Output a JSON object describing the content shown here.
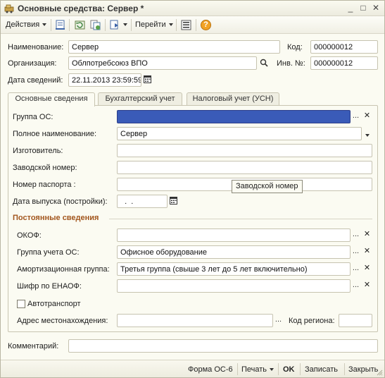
{
  "window": {
    "title": "Основные средства: Сервер *",
    "minimize": "_",
    "maximize": "□",
    "close": "✕"
  },
  "toolbar": {
    "actions_label": "Действия",
    "goto_label": "Перейти",
    "help_symbol": "?"
  },
  "header": {
    "name_label": "Наименование:",
    "name_value": "Сервер",
    "code_label": "Код:",
    "code_value": "000000012",
    "org_label": "Организация:",
    "org_value": "Облпотребсоюз ВПО",
    "inv_label": "Инв. №:",
    "inv_value": "000000012",
    "date_label": "Дата сведений:",
    "date_value": "22.11.2013 23:59:59"
  },
  "tabs": [
    {
      "label": "Основные сведения",
      "active": true
    },
    {
      "label": "Бухгалтерский учет",
      "active": false
    },
    {
      "label": "Налоговый учет (УСН)",
      "active": false
    }
  ],
  "main": {
    "group_os_label": "Группа ОС:",
    "group_os_value": "",
    "full_name_label": "Полное наименование:",
    "full_name_value": "Сервер",
    "manufacturer_label": "Изготовитель:",
    "manufacturer_value": "",
    "serial_label": "Заводской номер:",
    "serial_value": "",
    "passport_label": "Номер паспорта :",
    "passport_value": "",
    "release_date_label": "Дата выпуска (постройки):",
    "release_date_value": "  .  .",
    "tooltip": "Заводской номер"
  },
  "constant": {
    "section_title": "Постоянные сведения",
    "okof_label": "ОКОФ:",
    "okof_value": "",
    "group_uchet_label": "Группа учета ОС:",
    "group_uchet_value": "Офисное оборудование",
    "amort_label": "Амортизационная группа:",
    "amort_value": "Третья группа (свыше 3 лет до 5 лет включительно)",
    "enaof_label": "Шифр по ЕНАОФ:",
    "enaof_value": "",
    "auto_label": "Автотранспорт",
    "auto_checked": false,
    "address_label": "Адрес местонахождения:",
    "address_value": "",
    "region_label": "Код региона:",
    "region_value": ""
  },
  "comment": {
    "label": "Комментарий:",
    "value": ""
  },
  "bottom": {
    "form_label": "Форма ОС-6",
    "print_label": "Печать",
    "ok_label": "OK",
    "save_label": "Записать",
    "close_label": "Закрыть"
  },
  "symbols": {
    "ellipsis": "...",
    "clear": "✕"
  },
  "colors": {
    "selected_field": "#3a5bb8",
    "section_title": "#a2561d",
    "window_bg": "#fbfbf2"
  }
}
